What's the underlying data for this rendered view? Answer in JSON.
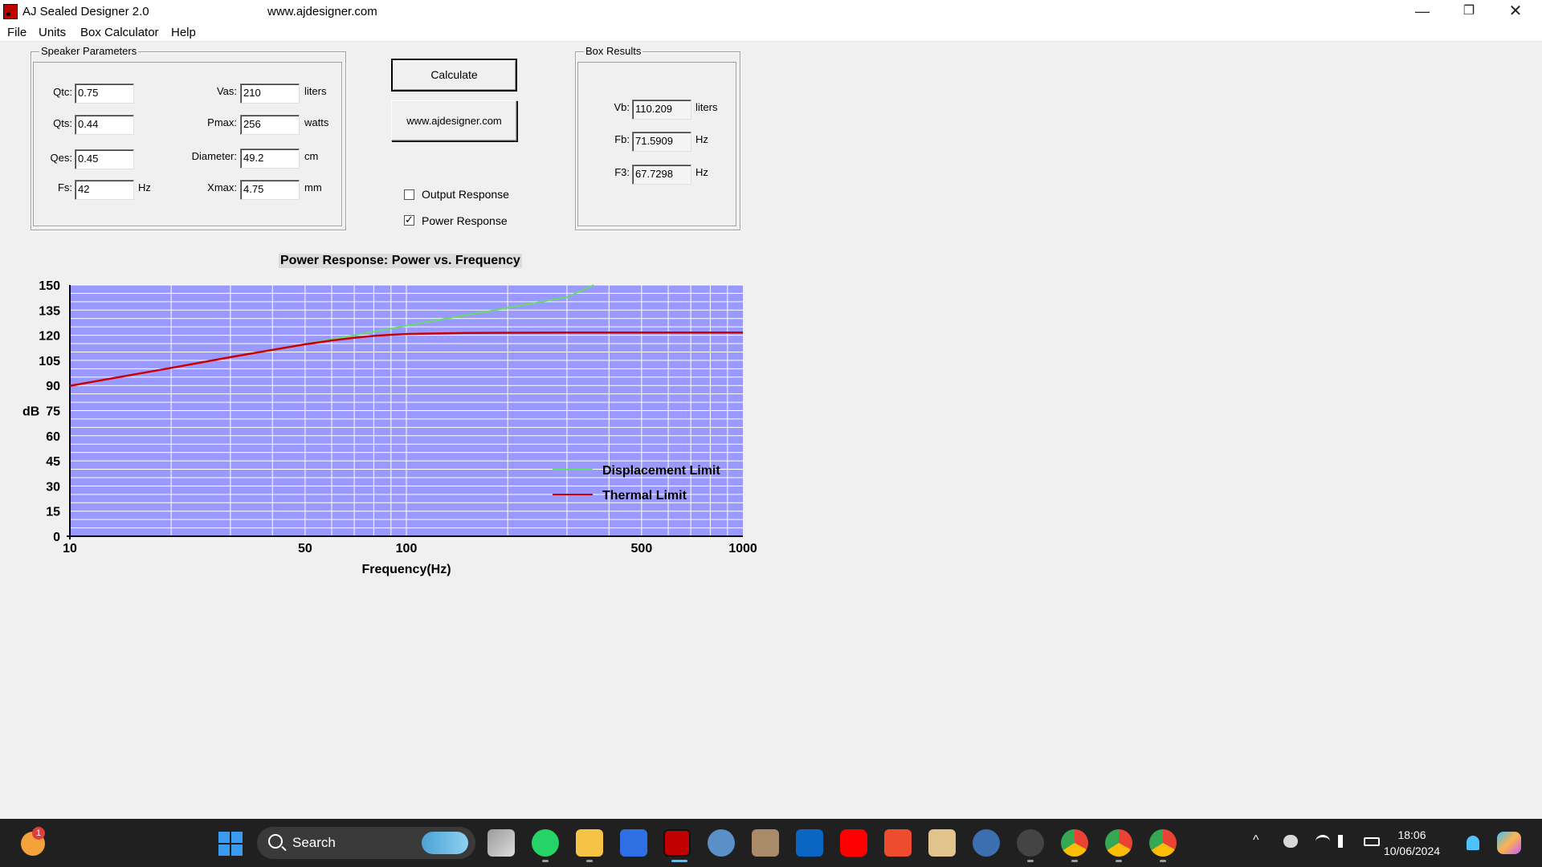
{
  "window": {
    "title": "AJ Sealed Designer 2.0",
    "url_caption": "www.ajdesigner.com",
    "minimize_glyph": "—",
    "maximize_glyph": "❐",
    "close_glyph": "✕"
  },
  "menu": {
    "items": [
      "File",
      "Units",
      "Box Calculator",
      "Help"
    ]
  },
  "speaker_params": {
    "title": "Speaker Parameters",
    "qtc": {
      "label": "Qtc:",
      "value": "0.75"
    },
    "qts": {
      "label": "Qts:",
      "value": "0.44"
    },
    "qes": {
      "label": "Qes:",
      "value": "0.45"
    },
    "fs": {
      "label": "Fs:",
      "value": "42",
      "unit": "Hz"
    },
    "vas": {
      "label": "Vas:",
      "value": "210",
      "unit": "liters"
    },
    "pmax": {
      "label": "Pmax:",
      "value": "256",
      "unit": "watts"
    },
    "diameter": {
      "label": "Diameter:",
      "value": "49.2",
      "unit": "cm"
    },
    "xmax": {
      "label": "Xmax:",
      "value": "4.75",
      "unit": "mm"
    }
  },
  "actions": {
    "calculate_label": "Calculate",
    "website_label": "www.ajdesigner.com",
    "output_response": {
      "label": "Output Response",
      "checked": false
    },
    "power_response": {
      "label": "Power Response",
      "checked": true
    }
  },
  "box_results": {
    "title": "Box Results",
    "vb": {
      "label": "Vb:",
      "value": "110.209",
      "unit": "liters"
    },
    "fb": {
      "label": "Fb:",
      "value": "71.5909",
      "unit": "Hz"
    },
    "f3": {
      "label": "F3:",
      "value": "67.7298",
      "unit": "Hz"
    }
  },
  "chart_data": {
    "type": "line",
    "title": "Power Response: Power vs. Frequency",
    "xlabel": "Frequency(Hz)",
    "ylabel": "dB",
    "x_scale": "log",
    "xlim": [
      10,
      1000
    ],
    "ylim": [
      0,
      150
    ],
    "x_ticks": [
      10,
      50,
      100,
      500,
      1000
    ],
    "y_ticks": [
      0,
      15,
      30,
      45,
      60,
      75,
      90,
      105,
      120,
      135,
      150
    ],
    "grid": true,
    "plot_background": "#9999ff",
    "legend_position": "bottom-right",
    "series": [
      {
        "name": "Displacement Limit",
        "color": "#66dd66",
        "x": [
          10,
          20,
          30,
          40,
          50,
          70,
          100,
          150,
          200,
          300,
          360
        ],
        "y": [
          89.8,
          100.5,
          106.9,
          111.3,
          114.8,
          120.0,
          125.7,
          132.0,
          136.4,
          142.7,
          150
        ]
      },
      {
        "name": "Thermal Limit",
        "color": "#cc0000",
        "x": [
          10,
          20,
          30,
          40,
          50,
          60,
          70,
          80,
          90,
          100,
          150,
          200,
          300,
          500,
          1000
        ],
        "y": [
          89.8,
          100.5,
          106.9,
          111.3,
          114.6,
          116.9,
          118.5,
          119.6,
          120.3,
          120.7,
          121.4,
          121.5,
          121.6,
          121.6,
          121.6
        ]
      }
    ]
  },
  "taskbar": {
    "weather_badge": "1",
    "search_label": "Search",
    "time": "18:06",
    "date": "10/06/2024",
    "chevron": "^"
  }
}
